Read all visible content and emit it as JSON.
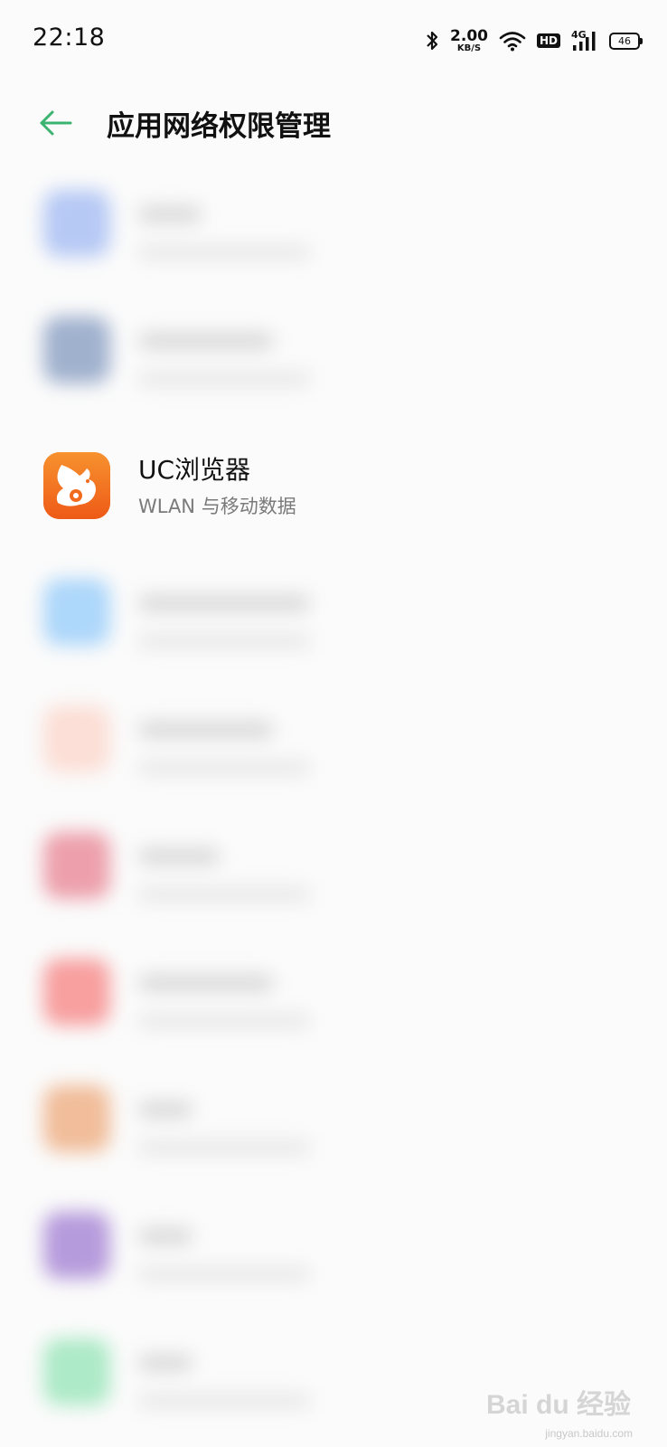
{
  "status_bar": {
    "time": "22:18",
    "net_speed": "2.00",
    "net_speed_unit": "KB/S",
    "hd_label": "HD",
    "signal_label": "4G",
    "battery": "46"
  },
  "header": {
    "title": "应用网络权限管理",
    "accent_color": "#3cb371"
  },
  "apps": [
    {
      "name": "UC浏览器",
      "permission": "WLAN 与移动数据",
      "icon": "uc-browser-squirrel-icon",
      "icon_color": "#f26b1d"
    }
  ],
  "watermark": {
    "text": "Bai du 经验",
    "url": "jingyan.baidu.com"
  }
}
